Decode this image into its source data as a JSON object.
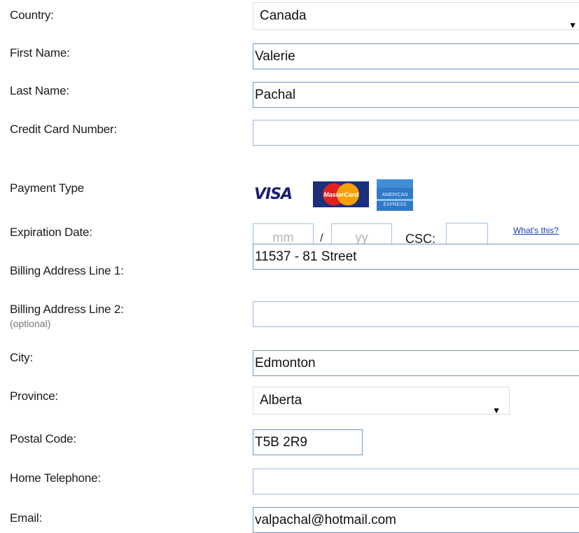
{
  "form": {
    "country": {
      "label": "Country:",
      "value": "Canada"
    },
    "first_name": {
      "label": "First Name:",
      "value": "Valerie"
    },
    "last_name": {
      "label": "Last Name:",
      "value": "Pachal"
    },
    "card_number": {
      "label": "Credit Card Number:",
      "value": ""
    },
    "payment_type": {
      "label": "Payment Type",
      "cards": [
        "VISA",
        "MasterCard",
        "American Express"
      ]
    },
    "expiration": {
      "label": "Expiration Date:",
      "month_placeholder": "mm",
      "separator": "/",
      "year_placeholder": "yy",
      "csc_label": "CSC:",
      "whats_this": "What's this?"
    },
    "address1": {
      "label": "Billing Address Line 1:",
      "value": "11537 - 81 Street"
    },
    "address2": {
      "label": "Billing Address Line 2:",
      "hint": "(optional)",
      "value": ""
    },
    "city": {
      "label": "City:",
      "value": "Edmonton"
    },
    "province": {
      "label": "Province:",
      "value": "Alberta"
    },
    "postal_code": {
      "label": "Postal Code:",
      "value": "T5B 2R9"
    },
    "home_phone": {
      "label": "Home Telephone:",
      "value": ""
    },
    "email": {
      "label": "Email:",
      "value": "valpachal@hotmail.com"
    }
  },
  "colors": {
    "field_border": "#6f97c6",
    "link": "#1c3fa8",
    "visa_blue": "#1a1f71",
    "mc_red": "#e0211d",
    "mc_orange": "#f6a000",
    "amex_blue": "#2f79c8"
  }
}
